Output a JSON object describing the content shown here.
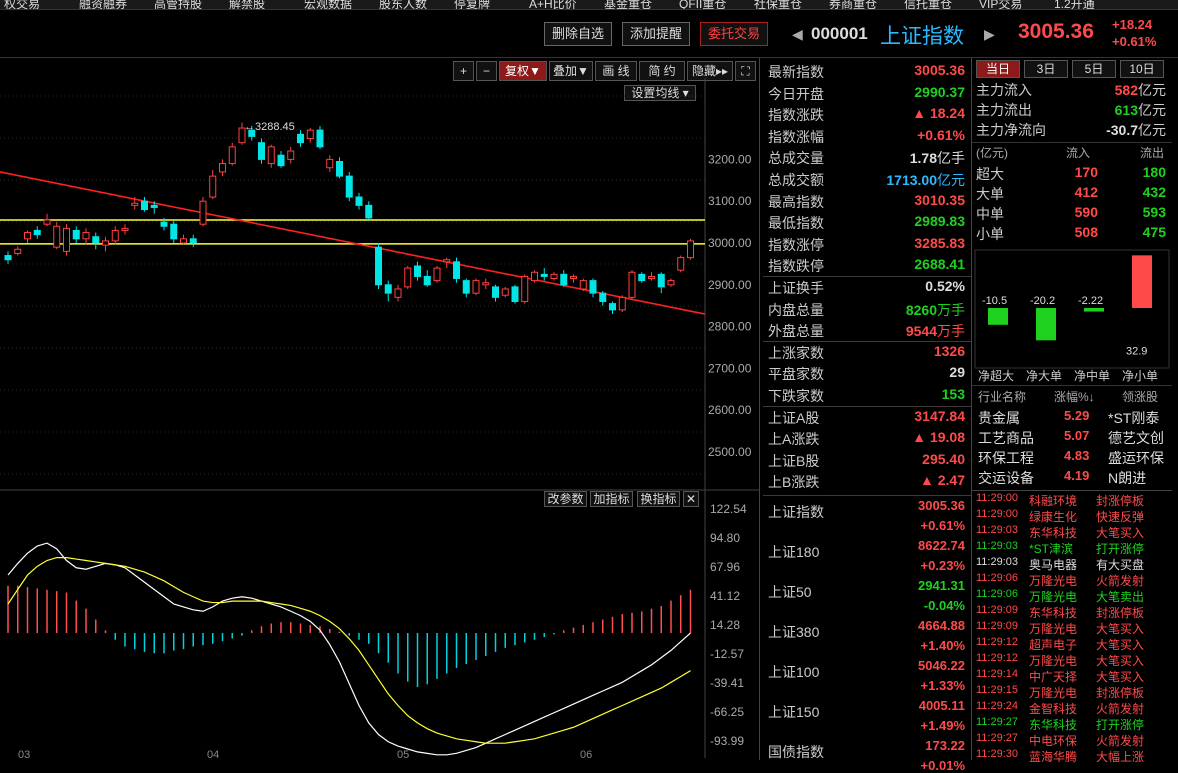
{
  "topmenu": [
    "权交易",
    "融资融券",
    "高管持股",
    "解禁股",
    "宏观数据",
    "股东人数",
    "停复牌",
    "A+H比价",
    "基金重仓",
    "QFII重仓",
    "社保重仓",
    "券商重仓",
    "信托重仓",
    "VIP交易",
    "1.2开通"
  ],
  "header": {
    "btn_delete": "删除自选",
    "btn_alert": "添加提醒",
    "btn_trade": "委托交易",
    "code": "000001",
    "name": "上证指数",
    "price": "3005.36",
    "change": "+18.24",
    "change_pct": "+0.61%"
  },
  "toolbar": {
    "plus": "+",
    "minus": "−",
    "fq": "复权▼",
    "overlay": "叠加▼",
    "draw": "画 线",
    "simple": "简 约",
    "hide": "隐藏▸▸",
    "ma_setting": "设置均线 ▾"
  },
  "kline": {
    "high_label": "←3288.45",
    "price_axis": [
      "3200.00",
      "3100.00",
      "3000.00",
      "2900.00",
      "2800.00",
      "2700.00",
      "2600.00",
      "2500.00"
    ],
    "months": [
      "03",
      "04",
      "05",
      "06"
    ],
    "candles": [
      [
        2970,
        2960,
        2980,
        2950
      ],
      [
        2975,
        2985,
        2992,
        2970
      ],
      [
        3010,
        3025,
        3030,
        3000
      ],
      [
        3030,
        3020,
        3040,
        3010
      ],
      [
        3045,
        3055,
        3070,
        3040
      ],
      [
        2990,
        3040,
        3050,
        2985
      ],
      [
        2980,
        3035,
        3045,
        2970
      ],
      [
        3030,
        3010,
        3040,
        3000
      ],
      [
        3010,
        3025,
        3035,
        2995
      ],
      [
        3015,
        3000,
        3025,
        2985
      ],
      [
        2995,
        3005,
        3015,
        2980
      ],
      [
        3005,
        3030,
        3040,
        2995
      ],
      [
        3030,
        3035,
        3045,
        3020
      ],
      [
        3090,
        3095,
        3110,
        3080
      ],
      [
        3100,
        3080,
        3110,
        3075
      ],
      [
        3090,
        3085,
        3100,
        3070
      ],
      [
        3050,
        3040,
        3060,
        3030
      ],
      [
        3045,
        3010,
        3055,
        3000
      ],
      [
        3000,
        3010,
        3020,
        2995
      ],
      [
        3010,
        3000,
        3020,
        2990
      ],
      [
        3045,
        3100,
        3110,
        3040
      ],
      [
        3110,
        3160,
        3175,
        3105
      ],
      [
        3170,
        3190,
        3200,
        3160
      ],
      [
        3190,
        3230,
        3240,
        3185
      ],
      [
        3240,
        3275,
        3288,
        3235
      ],
      [
        3270,
        3255,
        3280,
        3245
      ],
      [
        3240,
        3200,
        3250,
        3190
      ],
      [
        3190,
        3230,
        3235,
        3180
      ],
      [
        3210,
        3185,
        3220,
        3180
      ],
      [
        3200,
        3220,
        3230,
        3190
      ],
      [
        3260,
        3240,
        3270,
        3230
      ],
      [
        3250,
        3270,
        3275,
        3240
      ],
      [
        3270,
        3230,
        3280,
        3225
      ],
      [
        3180,
        3200,
        3210,
        3170
      ],
      [
        3195,
        3160,
        3205,
        3155
      ],
      [
        3160,
        3110,
        3170,
        3100
      ],
      [
        3110,
        3090,
        3120,
        3080
      ],
      [
        3090,
        3060,
        3100,
        3055
      ],
      [
        2990,
        2900,
        3000,
        2890
      ],
      [
        2900,
        2880,
        2910,
        2860
      ],
      [
        2870,
        2890,
        2900,
        2860
      ],
      [
        2895,
        2940,
        2945,
        2890
      ],
      [
        2945,
        2920,
        2955,
        2910
      ],
      [
        2920,
        2900,
        2935,
        2895
      ],
      [
        2910,
        2940,
        2945,
        2905
      ],
      [
        2955,
        2960,
        2965,
        2940
      ],
      [
        2955,
        2915,
        2965,
        2905
      ],
      [
        2910,
        2880,
        2915,
        2870
      ],
      [
        2880,
        2910,
        2915,
        2875
      ],
      [
        2900,
        2905,
        2915,
        2890
      ],
      [
        2895,
        2870,
        2900,
        2860
      ],
      [
        2875,
        2890,
        2895,
        2870
      ],
      [
        2895,
        2860,
        2900,
        2855
      ],
      [
        2860,
        2920,
        2925,
        2855
      ],
      [
        2910,
        2930,
        2935,
        2905
      ],
      [
        2925,
        2920,
        2940,
        2910
      ],
      [
        2915,
        2925,
        2930,
        2910
      ],
      [
        2925,
        2900,
        2935,
        2895
      ],
      [
        2915,
        2920,
        2925,
        2905
      ],
      [
        2890,
        2910,
        2915,
        2885
      ],
      [
        2910,
        2880,
        2915,
        2870
      ],
      [
        2880,
        2860,
        2885,
        2850
      ],
      [
        2855,
        2840,
        2860,
        2830
      ],
      [
        2840,
        2870,
        2875,
        2835
      ],
      [
        2870,
        2930,
        2935,
        2865
      ],
      [
        2925,
        2910,
        2930,
        2905
      ],
      [
        2915,
        2920,
        2930,
        2910
      ],
      [
        2925,
        2895,
        2930,
        2880
      ],
      [
        2900,
        2910,
        2915,
        2895
      ],
      [
        2935,
        2965,
        2970,
        2930
      ],
      [
        2965,
        3005,
        3010,
        2960
      ]
    ]
  },
  "macd": {
    "buttons": [
      "改参数",
      "加指标",
      "换指标",
      "✕"
    ],
    "axis": [
      "122.54",
      "94.80",
      "67.96",
      "41.12",
      "14.28",
      "-12.57",
      "-39.41",
      "-66.25",
      "-93.99"
    ],
    "hist": [
      35,
      35,
      34,
      33,
      32,
      31,
      30,
      24,
      18,
      10,
      2,
      -5,
      -10,
      -12,
      -14,
      -15,
      -15,
      -13,
      -12,
      -10,
      -9,
      -8,
      -6,
      -4,
      -2,
      2,
      5,
      7,
      8,
      8,
      7,
      6,
      5,
      3,
      1,
      -2,
      -5,
      -8,
      -15,
      -22,
      -30,
      -36,
      -40,
      -38,
      -34,
      -30,
      -26,
      -23,
      -20,
      -17,
      -14,
      -11,
      -9,
      -7,
      -5,
      -3,
      -1,
      2,
      4,
      6,
      8,
      10,
      12,
      14,
      15,
      16,
      18,
      20,
      24,
      28,
      32
    ],
    "dif": [
      40,
      48,
      55,
      60,
      62,
      58,
      50,
      45,
      44,
      46,
      48,
      47,
      45,
      40,
      35,
      30,
      25,
      20,
      18,
      16,
      15,
      18,
      22,
      24,
      25,
      24,
      22,
      20,
      18,
      15,
      12,
      8,
      2,
      -8,
      -20,
      -35,
      -50,
      -62,
      -70,
      -75,
      -78,
      -80,
      -82,
      -83,
      -84,
      -84,
      -83,
      -81,
      -79,
      -76,
      -73,
      -70,
      -67,
      -64,
      -61,
      -58,
      -55,
      -52,
      -49,
      -46,
      -43,
      -40,
      -37,
      -34,
      -30,
      -26,
      -22,
      -17,
      -12,
      -6,
      0
    ],
    "dea": [
      20,
      30,
      40,
      46,
      50,
      52,
      52,
      51,
      50,
      49,
      48,
      47,
      46,
      44,
      42,
      39,
      36,
      32,
      28,
      25,
      22,
      21,
      21,
      22,
      22,
      22,
      22,
      21,
      20,
      19,
      17,
      15,
      12,
      8,
      3,
      -4,
      -12,
      -22,
      -32,
      -42,
      -50,
      -57,
      -62,
      -66,
      -69,
      -71,
      -73,
      -74,
      -75,
      -76,
      -76,
      -76,
      -75,
      -74,
      -73,
      -71,
      -69,
      -67,
      -65,
      -62,
      -59,
      -56,
      -53,
      -50,
      -47,
      -44,
      -41,
      -38,
      -34,
      -30,
      -26
    ]
  },
  "quote": [
    {
      "label": "最新指数",
      "value": "3005.36",
      "color": "red"
    },
    {
      "label": "今日开盘",
      "value": "2990.37",
      "color": "grn"
    },
    {
      "label": "指数涨跌",
      "value": "▲ 18.24",
      "color": "red"
    },
    {
      "label": "指数涨幅",
      "value": "+0.61%",
      "color": "red"
    },
    {
      "label": "总成交量",
      "value": "1.78",
      "unit": "亿手",
      "color": "wht"
    },
    {
      "label": "总成交额",
      "value": "1713.00",
      "unit": "亿元",
      "color": "cy"
    },
    {
      "label": "最高指数",
      "value": "3010.35",
      "color": "red"
    },
    {
      "label": "最低指数",
      "value": "2989.83",
      "color": "grn"
    },
    {
      "label": "指数涨停",
      "value": "3285.83",
      "color": "red"
    },
    {
      "label": "指数跌停",
      "value": "2688.41",
      "color": "grn"
    },
    {
      "label": "上证换手",
      "value": "0.52%",
      "color": "wht"
    },
    {
      "label": "内盘总量",
      "value": "8260",
      "unit": "万手",
      "color": "grn"
    },
    {
      "label": "外盘总量",
      "value": "9544",
      "unit": "万手",
      "color": "red"
    },
    {
      "label": "上涨家数",
      "value": "1326",
      "color": "red"
    },
    {
      "label": "平盘家数",
      "value": "29",
      "color": "wht"
    },
    {
      "label": "下跌家数",
      "value": "153",
      "color": "grn"
    },
    {
      "label": "上证A股",
      "value": "3147.84",
      "color": "red"
    },
    {
      "label": "上A涨跌",
      "value": "▲ 19.08",
      "color": "red"
    },
    {
      "label": "上证B股",
      "value": "295.40",
      "color": "red"
    },
    {
      "label": "上B涨跌",
      "value": "▲ 2.47",
      "color": "red"
    }
  ],
  "indices": [
    {
      "name": "上证指数",
      "value": "3005.36",
      "pct": "+0.61%",
      "color": "red"
    },
    {
      "name": "上证180",
      "value": "8622.74",
      "pct": "+0.23%",
      "color": "red"
    },
    {
      "name": "上证50",
      "value": "2941.31",
      "pct": "-0.04%",
      "color": "grn"
    },
    {
      "name": "上证380",
      "value": "4664.88",
      "pct": "+1.40%",
      "color": "red"
    },
    {
      "name": "上证100",
      "value": "5046.22",
      "pct": "+1.33%",
      "color": "red"
    },
    {
      "name": "上证150",
      "value": "4005.11",
      "pct": "+1.49%",
      "color": "red"
    },
    {
      "name": "国债指数",
      "value": "173.22",
      "pct": "+0.01%",
      "color": "red"
    }
  ],
  "flow": {
    "tabs": [
      "当日",
      "3日",
      "5日",
      "10日"
    ],
    "main": [
      {
        "label": "主力流入",
        "value": "582",
        "unit": "亿元",
        "color": "red"
      },
      {
        "label": "主力流出",
        "value": "613",
        "unit": "亿元",
        "color": "grn"
      },
      {
        "label": "主力净流向",
        "value": "-30.7",
        "unit": "亿元",
        "color": "wht"
      }
    ],
    "head": [
      "(亿元)",
      "流入",
      "流出"
    ],
    "rows": [
      {
        "name": "超大",
        "in": "170",
        "out": "180"
      },
      {
        "name": "大单",
        "in": "412",
        "out": "432"
      },
      {
        "name": "中单",
        "in": "590",
        "out": "593"
      },
      {
        "name": "小单",
        "in": "508",
        "out": "475"
      }
    ],
    "bars": [
      {
        "label": "净超大",
        "value": -10.5,
        "text": "-10.5"
      },
      {
        "label": "净大单",
        "value": -20.2,
        "text": "-20.2"
      },
      {
        "label": "净中单",
        "value": -2.22,
        "text": "-2.22"
      },
      {
        "label": "净小单",
        "value": 32.9,
        "text": "32.9"
      }
    ],
    "sector_head": [
      "行业名称",
      "涨幅%↓",
      "领涨股"
    ],
    "sectors": [
      {
        "name": "贵金属",
        "pct": "5.29",
        "lead": "*ST刚泰"
      },
      {
        "name": "工艺商品",
        "pct": "5.07",
        "lead": "德艺文创"
      },
      {
        "name": "环保工程",
        "pct": "4.83",
        "lead": "盛运环保"
      },
      {
        "name": "交运设备",
        "pct": "4.19",
        "lead": "N朗进"
      }
    ],
    "ticks": [
      {
        "t": "11:29:00",
        "s": "科融环境",
        "e": "封涨停板"
      },
      {
        "t": "11:29:00",
        "s": "绿康生化",
        "e": "快速反弹"
      },
      {
        "t": "11:29:03",
        "s": "东华科技",
        "e": "大笔买入"
      },
      {
        "t": "11:29:03",
        "s": "*ST津滨",
        "e": "打开涨停"
      },
      {
        "t": "11:29:03",
        "s": "奥马电器",
        "e": "有大买盘"
      },
      {
        "t": "11:29:06",
        "s": "万隆光电",
        "e": "火箭发射"
      },
      {
        "t": "11:29:06",
        "s": "万隆光电",
        "e": "大笔卖出"
      },
      {
        "t": "11:29:09",
        "s": "东华科技",
        "e": "封涨停板"
      },
      {
        "t": "11:29:09",
        "s": "万隆光电",
        "e": "大笔买入"
      },
      {
        "t": "11:29:12",
        "s": "超声电子",
        "e": "大笔买入"
      },
      {
        "t": "11:29:12",
        "s": "万隆光电",
        "e": "大笔买入"
      },
      {
        "t": "11:29:14",
        "s": "中广天择",
        "e": "大笔买入"
      },
      {
        "t": "11:29:15",
        "s": "万隆光电",
        "e": "封涨停板"
      },
      {
        "t": "11:29:24",
        "s": "金智科技",
        "e": "火箭发射"
      },
      {
        "t": "11:29:27",
        "s": "东华科技",
        "e": "打开涨停"
      },
      {
        "t": "11:29:27",
        "s": "中电环保",
        "e": "火箭发射"
      },
      {
        "t": "11:29:30",
        "s": "蓝海华腾",
        "e": "大幅上涨"
      }
    ]
  }
}
